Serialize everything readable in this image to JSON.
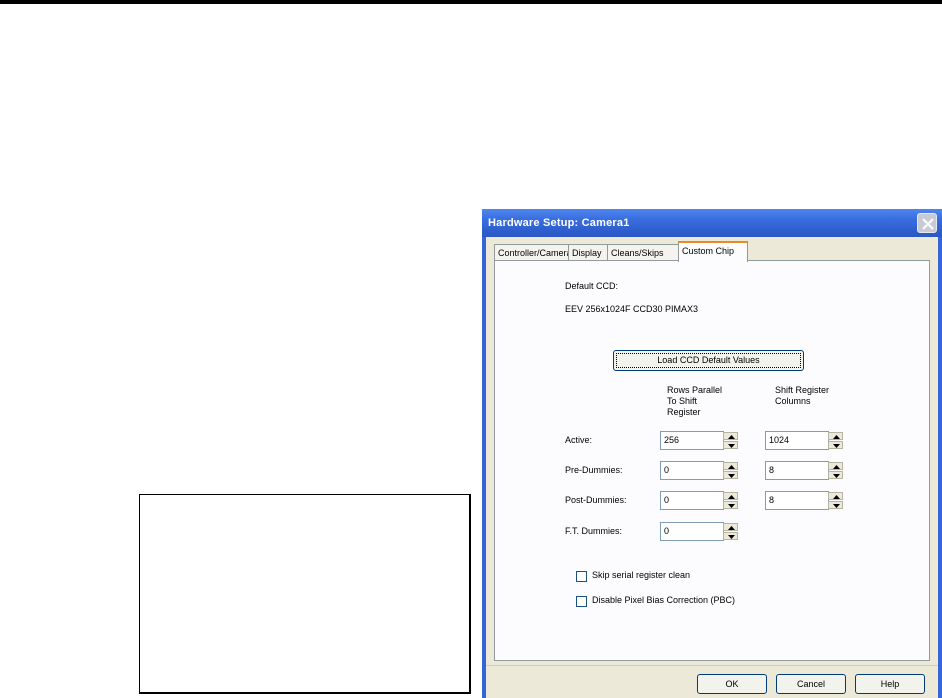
{
  "dialog": {
    "title": "Hardware Setup: Camera1",
    "tabs": [
      "Controller/Camera",
      "Display",
      "Cleans/Skips",
      "Custom Chip"
    ],
    "active_tab": "Custom Chip"
  },
  "custom_chip": {
    "default_ccd_label": "Default CCD:",
    "default_ccd_value": "EEV 256x1024F CCD30 PIMAX3",
    "load_button": "Load CCD Default Values",
    "col_rows_header": "Rows Parallel To Shift Register",
    "col_cols_header": "Shift Register Columns",
    "rows": [
      {
        "label": "Active:",
        "rows_value": "256",
        "cols_value": "1024"
      },
      {
        "label": "Pre-Dummies:",
        "rows_value": "0",
        "cols_value": "8"
      },
      {
        "label": "Post-Dummies:",
        "rows_value": "0",
        "cols_value": "8"
      },
      {
        "label": "F.T. Dummies:",
        "rows_value": "0"
      }
    ],
    "skip_serial_label": "Skip serial register clean",
    "skip_serial_checked": false,
    "disable_pbc_label": "Disable Pixel Bias Correction (PBC)",
    "disable_pbc_checked": false
  },
  "footer": {
    "ok": "OK",
    "cancel": "Cancel",
    "help": "Help"
  },
  "icons": {
    "close": "close-icon",
    "spin_up": "arrow-up-icon",
    "spin_down": "arrow-down-icon"
  }
}
